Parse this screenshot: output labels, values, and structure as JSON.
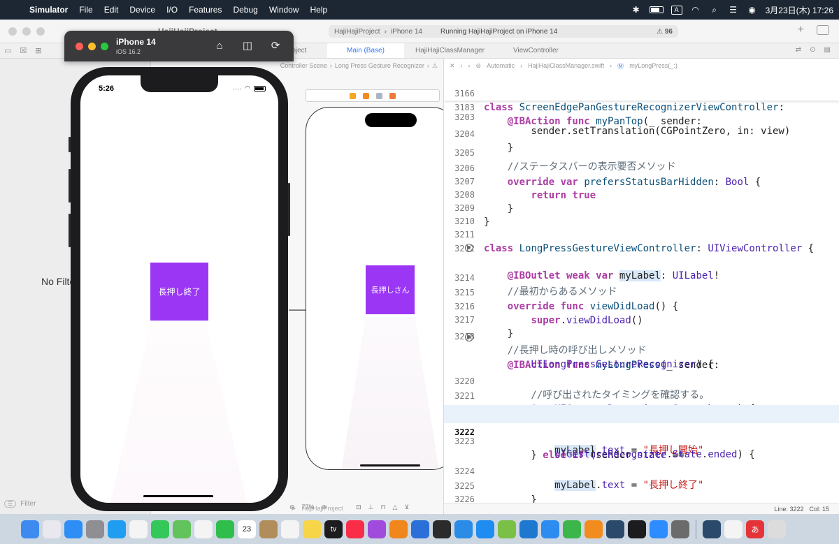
{
  "menubar": {
    "app_name": "Simulator",
    "menus": [
      "File",
      "Edit",
      "Device",
      "I/O",
      "Features",
      "Debug",
      "Window",
      "Help"
    ],
    "input_indicator": "A",
    "clock": "3月23日(木)  17:26"
  },
  "xcode": {
    "title": "HajiHajiProject",
    "scheme": {
      "project": "HajiHajiProject",
      "device": "iPhone 14",
      "status": "Running HajiHajiProject on iPhone 14",
      "warnings": "96"
    },
    "tabs": [
      "roject",
      "Main (Base)",
      "HajiHajiClassManager",
      "ViewController"
    ],
    "navigator": {
      "no_filter": "No Filte",
      "filter_placeholder": "Filter"
    },
    "ib": {
      "jump_path": "Long Press Gesture Recognizer",
      "jump_scene": "Controller Scene",
      "label_text": "長押しさん",
      "zoom": "77%",
      "project_label": "HajiHajiProject"
    },
    "editor": {
      "jump": {
        "mode": "Automatic",
        "file": "HajiHajiClassManager.swift",
        "symbol": "myLongPress(_:)"
      },
      "status": {
        "line": "Line: 3222",
        "col": "Col: 15"
      },
      "lines": [
        {
          "n": "3166",
          "t": "class ScreenEdgePanGestureRecognizerViewController:"
        },
        {
          "n": "3183",
          "t": "    @IBAction func myPanTop(_ sender:"
        },
        {
          "n": "3203",
          "t": "        sender.setTranslation(CGPointZero, in: view)"
        },
        {
          "n": "3204",
          "t": "    }"
        },
        {
          "n": "3205",
          "t": "    //ステータスバーの表示要否メソッド"
        },
        {
          "n": "3206",
          "t": "    override var prefersStatusBarHidden: Bool {"
        },
        {
          "n": "3207",
          "t": "        return true"
        },
        {
          "n": "3208",
          "t": "    }"
        },
        {
          "n": "3209",
          "t": "}"
        },
        {
          "n": "3210",
          "t": ""
        },
        {
          "n": "3211",
          "t": "class LongPressGestureViewController: UIViewController {"
        },
        {
          "n": "3212",
          "t": ""
        },
        {
          "n": "",
          "t": "    @IBOutlet weak var myLabel: UILabel!"
        },
        {
          "n": "3214",
          "t": "    //最初からあるメソッド"
        },
        {
          "n": "3215",
          "t": "    override func viewDidLoad() {"
        },
        {
          "n": "3216",
          "t": "        super.viewDidLoad()"
        },
        {
          "n": "3217",
          "t": "    }"
        },
        {
          "n": "3218",
          "t": "    //長押し時の呼び出しメソッド"
        },
        {
          "n": "",
          "t": "    @IBAction func myLongPress(_ sender:"
        },
        {
          "n": "",
          "t": "        UILongPressGestureRecognizer) {"
        },
        {
          "n": "3220",
          "t": "        //呼び出されたタイミングを確認する。"
        },
        {
          "n": "3221",
          "t": "        if(sender.state =="
        },
        {
          "n": "",
          "t": "            UIGestureRecognizer.State.began) {"
        },
        {
          "n": "3222",
          "t": "            myLabel.text = \"長押し開始\""
        },
        {
          "n": "3223",
          "t": "        } else if (sender.state =="
        },
        {
          "n": "",
          "t": "            UIGestureRecognizer.State.ended) {"
        },
        {
          "n": "3224",
          "t": "            myLabel.text = \"長押し終了\""
        },
        {
          "n": "3225",
          "t": "        }"
        },
        {
          "n": "3226",
          "t": "    }"
        },
        {
          "n": "3227",
          "t": "}"
        }
      ]
    }
  },
  "simulator": {
    "device_name": "iPhone 14",
    "os_version": "iOS 16.2",
    "status_time": "5:26",
    "label_text": "長押し終了"
  },
  "colors": {
    "label_purple": "#9b36f5",
    "menubar_bg": "#1d2733",
    "accent": "#3478f6"
  },
  "dock": {
    "apps": [
      {
        "icon": "finder-icon",
        "color": "#3d8bef"
      },
      {
        "icon": "launchpad-icon",
        "color": "#e8e8ee"
      },
      {
        "icon": "mail-icon",
        "color": "#2e8ef5"
      },
      {
        "icon": "system-settings-icon",
        "color": "#8e8e93"
      },
      {
        "icon": "safari-icon",
        "color": "#1f9ef1"
      },
      {
        "icon": "chrome-icon",
        "color": "#f4f4f4"
      },
      {
        "icon": "messages-icon",
        "color": "#34c759"
      },
      {
        "icon": "maps-icon",
        "color": "#62c25b"
      },
      {
        "icon": "photos-icon",
        "color": "#f4f4f4"
      },
      {
        "icon": "facetime-icon",
        "color": "#2fbe4c"
      },
      {
        "icon": "calendar-icon",
        "color": "#ffffff",
        "text": "23"
      },
      {
        "icon": "contacts-icon",
        "color": "#b08d5b"
      },
      {
        "icon": "reminders-icon",
        "color": "#f4f4f4"
      },
      {
        "icon": "notes-icon",
        "color": "#f7d548"
      },
      {
        "icon": "tv-icon",
        "color": "#1c1c1e",
        "text": "tv"
      },
      {
        "icon": "music-icon",
        "color": "#fa2d48"
      },
      {
        "icon": "podcasts-icon",
        "color": "#a14bdc"
      },
      {
        "icon": "books-icon",
        "color": "#f0861c"
      },
      {
        "icon": "pencil-app-icon",
        "color": "#2b6fd8"
      },
      {
        "icon": "script-editor-icon",
        "color": "#2b2b2b"
      },
      {
        "icon": "cloud-app-icon",
        "color": "#2a8ce6"
      },
      {
        "icon": "app-store-icon",
        "color": "#1e8cf0"
      },
      {
        "icon": "instruments-icon",
        "color": "#7ac046"
      },
      {
        "icon": "vscode-icon",
        "color": "#1f78cf"
      },
      {
        "icon": "keynote-icon",
        "color": "#2d8cf0"
      },
      {
        "icon": "numbers-icon",
        "color": "#3cb64a"
      },
      {
        "icon": "pages-icon",
        "color": "#f28c1f"
      },
      {
        "icon": "xcode-icon",
        "color": "#2b4a6b"
      },
      {
        "icon": "terminal-icon",
        "color": "#1c1c1e"
      },
      {
        "icon": "zoom-icon",
        "color": "#2d8cff"
      },
      {
        "icon": "calculator-icon",
        "color": "#6b6b6b"
      },
      {
        "icon": "simulator-icon",
        "color": "#2b4a6b"
      },
      {
        "icon": "textedit-icon",
        "color": "#f4f4f4"
      },
      {
        "icon": "kotoeri-icon",
        "color": "#e4343a",
        "text": "あ"
      },
      {
        "icon": "trash-icon",
        "color": "#dcdcdc"
      }
    ]
  }
}
